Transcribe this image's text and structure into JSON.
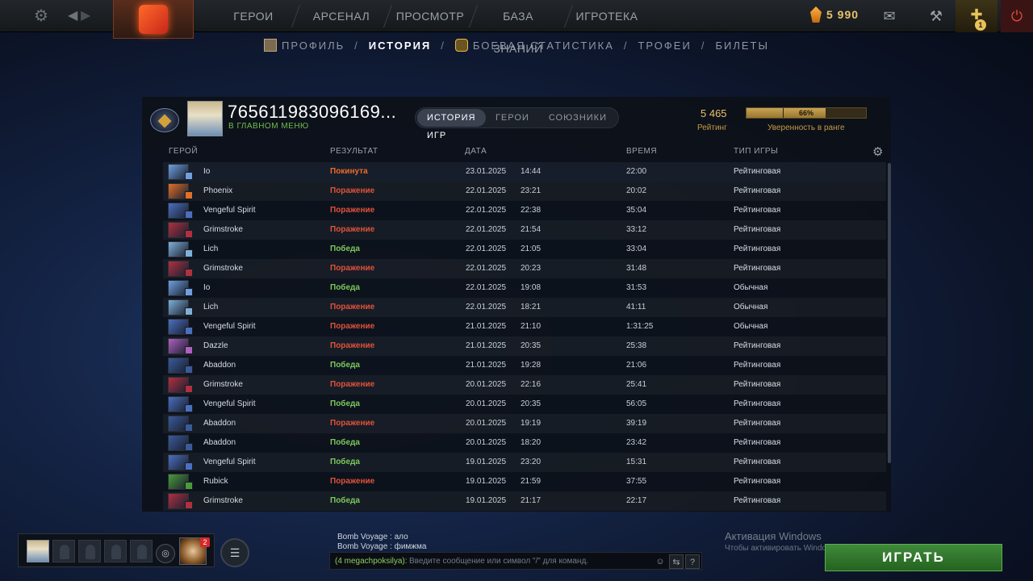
{
  "topnav": {
    "menu": [
      "ГЕРОИ",
      "АРСЕНАЛ",
      "ПРОСМОТР",
      "БАЗА ЗНАНИЙ",
      "ИГРОТЕКА"
    ],
    "currency_amount": "5 990",
    "quest_badge": "1",
    "icons": {
      "settings": "gear-icon",
      "back": "back-arrow-icon",
      "forward": "forward-arrow-icon",
      "chat": "chat-icon",
      "mail": "mail-icon",
      "armory": "armory-icon",
      "quest": "quest-icon",
      "power": "power-icon"
    }
  },
  "subnav": {
    "items": [
      "ПРОФИЛЬ",
      "ИСТОРИЯ",
      "БОЕВАЯ СТАТИСТИКА",
      "ТРОФЕИ",
      "БИЛЕТЫ"
    ],
    "separator": "/",
    "active_index": 1
  },
  "profile": {
    "player_id": "765611983096169...",
    "status": "В ГЛАВНОМ МЕНЮ",
    "tabs": [
      "ИСТОРИЯ ИГР",
      "ГЕРОИ",
      "СОЮЗНИКИ"
    ],
    "active_tab": 0,
    "rating_value": "5 465",
    "rating_label": "Рейтинг",
    "confidence_percent": 66,
    "confidence_text": "66%",
    "confidence_label": "Уверенность в ранге"
  },
  "table": {
    "headers": {
      "hero": "ГЕРОЙ",
      "result": "РЕЗУЛЬТАТ",
      "date": "ДАТА",
      "duration": "ВРЕМЯ",
      "type": "ТИП ИГРЫ"
    },
    "rows": [
      {
        "hero": "Io",
        "result": "Покинута",
        "status": "abandon",
        "date": "23.01.2025",
        "time": "14:44",
        "duration": "22:00",
        "type": "Рейтинговая"
      },
      {
        "hero": "Phoenix",
        "result": "Поражение",
        "status": "loss",
        "date": "22.01.2025",
        "time": "23:21",
        "duration": "20:02",
        "type": "Рейтинговая"
      },
      {
        "hero": "Vengeful Spirit",
        "result": "Поражение",
        "status": "loss",
        "date": "22.01.2025",
        "time": "22:38",
        "duration": "35:04",
        "type": "Рейтинговая"
      },
      {
        "hero": "Grimstroke",
        "result": "Поражение",
        "status": "loss",
        "date": "22.01.2025",
        "time": "21:54",
        "duration": "33:12",
        "type": "Рейтинговая"
      },
      {
        "hero": "Lich",
        "result": "Победа",
        "status": "win",
        "date": "22.01.2025",
        "time": "21:05",
        "duration": "33:04",
        "type": "Рейтинговая"
      },
      {
        "hero": "Grimstroke",
        "result": "Поражение",
        "status": "loss",
        "date": "22.01.2025",
        "time": "20:23",
        "duration": "31:48",
        "type": "Рейтинговая"
      },
      {
        "hero": "Io",
        "result": "Победа",
        "status": "win",
        "date": "22.01.2025",
        "time": "19:08",
        "duration": "31:53",
        "type": "Обычная"
      },
      {
        "hero": "Lich",
        "result": "Поражение",
        "status": "loss",
        "date": "22.01.2025",
        "time": "18:21",
        "duration": "41:11",
        "type": "Обычная"
      },
      {
        "hero": "Vengeful Spirit",
        "result": "Поражение",
        "status": "loss",
        "date": "21.01.2025",
        "time": "21:10",
        "duration": "1:31:25",
        "type": "Обычная"
      },
      {
        "hero": "Dazzle",
        "result": "Поражение",
        "status": "loss",
        "date": "21.01.2025",
        "time": "20:35",
        "duration": "25:38",
        "type": "Рейтинговая"
      },
      {
        "hero": "Abaddon",
        "result": "Победа",
        "status": "win",
        "date": "21.01.2025",
        "time": "19:28",
        "duration": "21:06",
        "type": "Рейтинговая"
      },
      {
        "hero": "Grimstroke",
        "result": "Поражение",
        "status": "loss",
        "date": "20.01.2025",
        "time": "22:16",
        "duration": "25:41",
        "type": "Рейтинговая"
      },
      {
        "hero": "Vengeful Spirit",
        "result": "Победа",
        "status": "win",
        "date": "20.01.2025",
        "time": "20:35",
        "duration": "56:05",
        "type": "Рейтинговая"
      },
      {
        "hero": "Abaddon",
        "result": "Поражение",
        "status": "loss",
        "date": "20.01.2025",
        "time": "19:19",
        "duration": "39:19",
        "type": "Рейтинговая"
      },
      {
        "hero": "Abaddon",
        "result": "Победа",
        "status": "win",
        "date": "20.01.2025",
        "time": "18:20",
        "duration": "23:42",
        "type": "Рейтинговая"
      },
      {
        "hero": "Vengeful Spirit",
        "result": "Победа",
        "status": "win",
        "date": "19.01.2025",
        "time": "23:20",
        "duration": "15:31",
        "type": "Рейтинговая"
      },
      {
        "hero": "Rubick",
        "result": "Поражение",
        "status": "loss",
        "date": "19.01.2025",
        "time": "21:59",
        "duration": "37:55",
        "type": "Рейтинговая"
      },
      {
        "hero": "Grimstroke",
        "result": "Победа",
        "status": "win",
        "date": "19.01.2025",
        "time": "21:17",
        "duration": "22:17",
        "type": "Рейтинговая"
      }
    ]
  },
  "colors": {
    "win": "#7cc95a",
    "loss": "#e0523a",
    "abandon": "#f06a2a",
    "accent_gold": "#e9c46a",
    "play_green": "#2f7a2a",
    "hero_portraits": {
      "Io": "#6f9fe0",
      "Phoenix": "#e0702a",
      "Vengeful Spirit": "#4a6fbf",
      "Grimstroke": "#b03040",
      "Lich": "#7fb0d8",
      "Dazzle": "#b060c0",
      "Abaddon": "#3a5a9a",
      "Rubick": "#4a9a3a"
    }
  },
  "party": {
    "pass_badge": "2",
    "icons": {
      "voice": "headset-icon",
      "friends": "friends-icon",
      "pass": "battle-pass-icon"
    }
  },
  "chat": {
    "messages": [
      "Bomb Voyage : ало",
      "Bomb Voyage : фимжма"
    ],
    "prefix": "(4 megachpoksilya):",
    "placeholder": "Введите сообщение или символ \"/\" для команд.",
    "help": "?"
  },
  "windows_activation": {
    "title": "Активация Windows",
    "subtitle": "Чтобы активировать Windows, перейдите в раздел \"Параметры\"."
  },
  "play_button": "ИГРАТЬ"
}
